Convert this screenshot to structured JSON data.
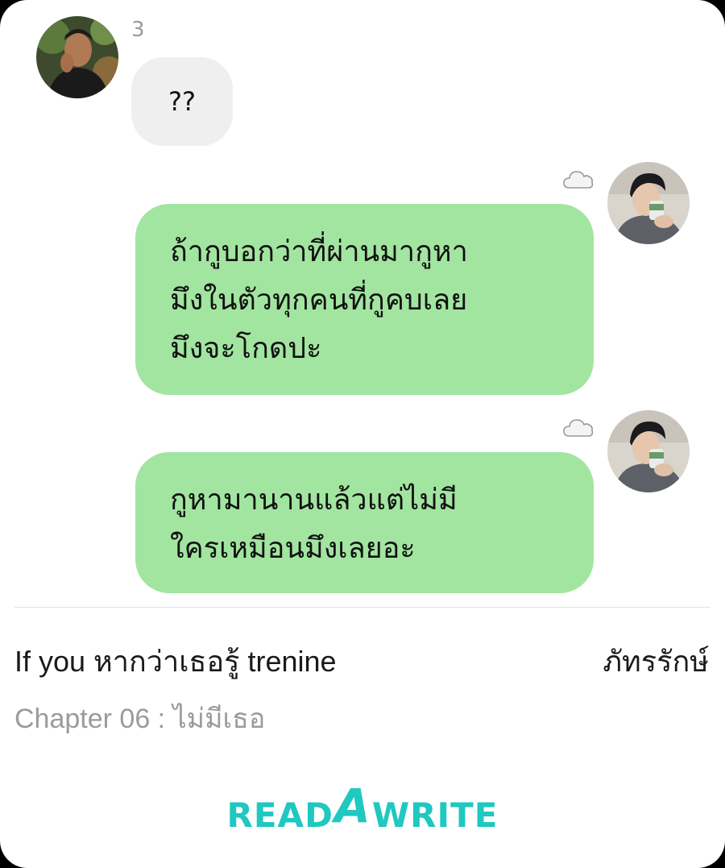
{
  "colors": {
    "incoming_bubble": "#efefef",
    "outgoing_bubble": "#a2e5a0",
    "brand": "#1fc8c0",
    "muted_text": "#9b9b9b"
  },
  "messages": [
    {
      "side": "incoming",
      "avatar": "avatar-photo-man-1",
      "read_count": "3",
      "text": "??"
    },
    {
      "side": "outgoing",
      "avatar": "avatar-photo-man-2",
      "status_icon": "cloud-icon",
      "text": "ถ้ากูบอกว่าที่ผ่านมากูหา\nมึงในตัวทุกคนที่กูคบเลย\nมึงจะโกดปะ"
    },
    {
      "side": "outgoing",
      "avatar": "avatar-photo-man-2",
      "status_icon": "cloud-icon",
      "text": "กูหามานานแล้วแต่ไม่มี\nใครเหมือนมึงเลยอะ"
    }
  ],
  "footer": {
    "story_title": "If you หากว่าเธอรู้ trenine",
    "author": "ภัทรรักษ์",
    "chapter": "Chapter 06 : ไม่มีเธอ",
    "brand": "READAWRITE"
  }
}
